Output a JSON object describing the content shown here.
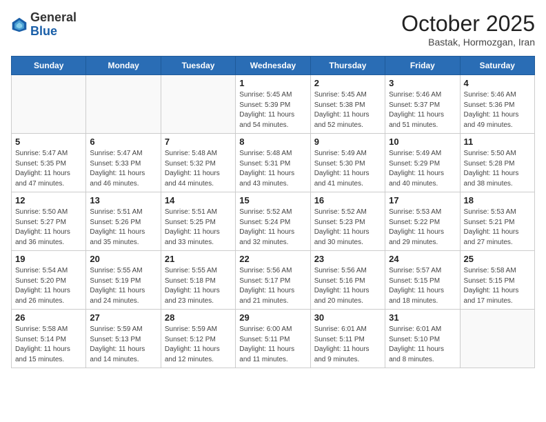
{
  "header": {
    "logo_general": "General",
    "logo_blue": "Blue",
    "month": "October 2025",
    "location": "Bastak, Hormozgan, Iran"
  },
  "weekdays": [
    "Sunday",
    "Monday",
    "Tuesday",
    "Wednesday",
    "Thursday",
    "Friday",
    "Saturday"
  ],
  "weeks": [
    [
      {
        "day": "",
        "info": ""
      },
      {
        "day": "",
        "info": ""
      },
      {
        "day": "",
        "info": ""
      },
      {
        "day": "1",
        "info": "Sunrise: 5:45 AM\nSunset: 5:39 PM\nDaylight: 11 hours\nand 54 minutes."
      },
      {
        "day": "2",
        "info": "Sunrise: 5:45 AM\nSunset: 5:38 PM\nDaylight: 11 hours\nand 52 minutes."
      },
      {
        "day": "3",
        "info": "Sunrise: 5:46 AM\nSunset: 5:37 PM\nDaylight: 11 hours\nand 51 minutes."
      },
      {
        "day": "4",
        "info": "Sunrise: 5:46 AM\nSunset: 5:36 PM\nDaylight: 11 hours\nand 49 minutes."
      }
    ],
    [
      {
        "day": "5",
        "info": "Sunrise: 5:47 AM\nSunset: 5:35 PM\nDaylight: 11 hours\nand 47 minutes."
      },
      {
        "day": "6",
        "info": "Sunrise: 5:47 AM\nSunset: 5:33 PM\nDaylight: 11 hours\nand 46 minutes."
      },
      {
        "day": "7",
        "info": "Sunrise: 5:48 AM\nSunset: 5:32 PM\nDaylight: 11 hours\nand 44 minutes."
      },
      {
        "day": "8",
        "info": "Sunrise: 5:48 AM\nSunset: 5:31 PM\nDaylight: 11 hours\nand 43 minutes."
      },
      {
        "day": "9",
        "info": "Sunrise: 5:49 AM\nSunset: 5:30 PM\nDaylight: 11 hours\nand 41 minutes."
      },
      {
        "day": "10",
        "info": "Sunrise: 5:49 AM\nSunset: 5:29 PM\nDaylight: 11 hours\nand 40 minutes."
      },
      {
        "day": "11",
        "info": "Sunrise: 5:50 AM\nSunset: 5:28 PM\nDaylight: 11 hours\nand 38 minutes."
      }
    ],
    [
      {
        "day": "12",
        "info": "Sunrise: 5:50 AM\nSunset: 5:27 PM\nDaylight: 11 hours\nand 36 minutes."
      },
      {
        "day": "13",
        "info": "Sunrise: 5:51 AM\nSunset: 5:26 PM\nDaylight: 11 hours\nand 35 minutes."
      },
      {
        "day": "14",
        "info": "Sunrise: 5:51 AM\nSunset: 5:25 PM\nDaylight: 11 hours\nand 33 minutes."
      },
      {
        "day": "15",
        "info": "Sunrise: 5:52 AM\nSunset: 5:24 PM\nDaylight: 11 hours\nand 32 minutes."
      },
      {
        "day": "16",
        "info": "Sunrise: 5:52 AM\nSunset: 5:23 PM\nDaylight: 11 hours\nand 30 minutes."
      },
      {
        "day": "17",
        "info": "Sunrise: 5:53 AM\nSunset: 5:22 PM\nDaylight: 11 hours\nand 29 minutes."
      },
      {
        "day": "18",
        "info": "Sunrise: 5:53 AM\nSunset: 5:21 PM\nDaylight: 11 hours\nand 27 minutes."
      }
    ],
    [
      {
        "day": "19",
        "info": "Sunrise: 5:54 AM\nSunset: 5:20 PM\nDaylight: 11 hours\nand 26 minutes."
      },
      {
        "day": "20",
        "info": "Sunrise: 5:55 AM\nSunset: 5:19 PM\nDaylight: 11 hours\nand 24 minutes."
      },
      {
        "day": "21",
        "info": "Sunrise: 5:55 AM\nSunset: 5:18 PM\nDaylight: 11 hours\nand 23 minutes."
      },
      {
        "day": "22",
        "info": "Sunrise: 5:56 AM\nSunset: 5:17 PM\nDaylight: 11 hours\nand 21 minutes."
      },
      {
        "day": "23",
        "info": "Sunrise: 5:56 AM\nSunset: 5:16 PM\nDaylight: 11 hours\nand 20 minutes."
      },
      {
        "day": "24",
        "info": "Sunrise: 5:57 AM\nSunset: 5:15 PM\nDaylight: 11 hours\nand 18 minutes."
      },
      {
        "day": "25",
        "info": "Sunrise: 5:58 AM\nSunset: 5:15 PM\nDaylight: 11 hours\nand 17 minutes."
      }
    ],
    [
      {
        "day": "26",
        "info": "Sunrise: 5:58 AM\nSunset: 5:14 PM\nDaylight: 11 hours\nand 15 minutes."
      },
      {
        "day": "27",
        "info": "Sunrise: 5:59 AM\nSunset: 5:13 PM\nDaylight: 11 hours\nand 14 minutes."
      },
      {
        "day": "28",
        "info": "Sunrise: 5:59 AM\nSunset: 5:12 PM\nDaylight: 11 hours\nand 12 minutes."
      },
      {
        "day": "29",
        "info": "Sunrise: 6:00 AM\nSunset: 5:11 PM\nDaylight: 11 hours\nand 11 minutes."
      },
      {
        "day": "30",
        "info": "Sunrise: 6:01 AM\nSunset: 5:11 PM\nDaylight: 11 hours\nand 9 minutes."
      },
      {
        "day": "31",
        "info": "Sunrise: 6:01 AM\nSunset: 5:10 PM\nDaylight: 11 hours\nand 8 minutes."
      },
      {
        "day": "",
        "info": ""
      }
    ]
  ]
}
